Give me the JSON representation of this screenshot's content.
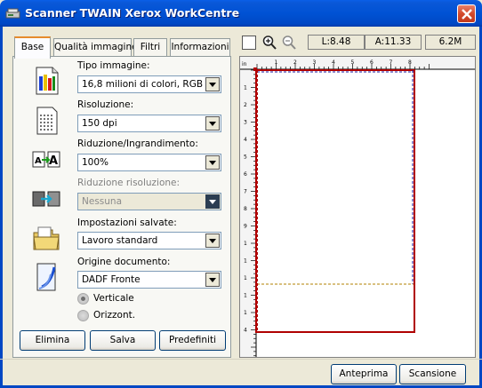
{
  "window": {
    "title": "Scanner TWAIN Xerox WorkCentre"
  },
  "tabs": [
    {
      "label": "Base",
      "active": true
    },
    {
      "label": "Qualità immagine",
      "active": false
    },
    {
      "label": "Filtri",
      "active": false
    },
    {
      "label": "Informazioni",
      "active": false
    }
  ],
  "fields": {
    "image_type": {
      "label": "Tipo immagine:",
      "value": "16,8 milioni di colori, RGB",
      "icon": "color-bars-icon"
    },
    "resolution": {
      "label": "Risoluzione:",
      "value": "150 dpi",
      "icon": "dotted-page-icon"
    },
    "scaling": {
      "label": "Riduzione/Ingrandimento:",
      "value": "100%",
      "icon": "resize-text-icon"
    },
    "descreen": {
      "label": "Riduzione risoluzione:",
      "value": "Nessuna",
      "disabled": true,
      "icon": "descreen-icon"
    },
    "saved_settings": {
      "label": "Impostazioni salvate:",
      "value": "Lavoro standard",
      "icon": "folder-icon"
    },
    "document_source": {
      "label": "Origine documento:",
      "value": "DADF Fronte",
      "icon": "document-icon"
    }
  },
  "orientation": {
    "portrait": {
      "label": "Verticale",
      "selected": true
    },
    "landscape": {
      "label": "Orizzont.",
      "selected": false
    }
  },
  "panel_buttons": {
    "delete": "Elimina",
    "save": "Salva",
    "defaults": "Predefiniti"
  },
  "preview_toolbar": {
    "length": "L:8.48",
    "area": "A:11.33",
    "size": "6.2M"
  },
  "ruler": {
    "unit": "in",
    "top_ticks": [
      "1",
      "2",
      "3",
      "4",
      "5",
      "6",
      "7",
      "8"
    ],
    "left_ticks": [
      "1",
      "2",
      "3",
      "4",
      "5",
      "6",
      "7",
      "8",
      "9",
      "1",
      "1",
      "1",
      "1",
      "1",
      "4"
    ]
  },
  "footer": {
    "preview": "Anteprima",
    "scan": "Scansione"
  },
  "colors": {
    "title_bar": "#0052d4",
    "scan_area_border": "#b00000",
    "page_border_dashed": "#1a1aa0",
    "tab_highlight": "#e68b2c"
  }
}
